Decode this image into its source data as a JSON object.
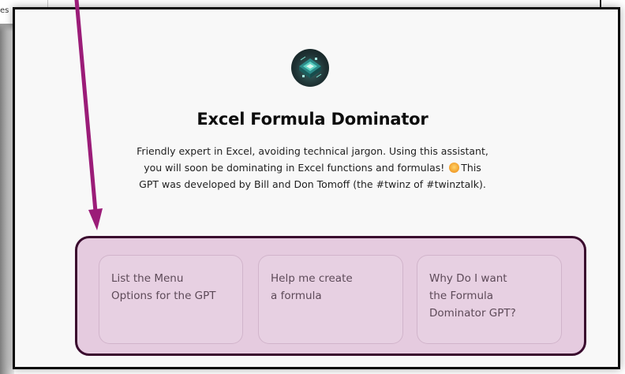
{
  "background_window": {
    "text_fragment": "es"
  },
  "gpt": {
    "name": "Excel Formula Dominator",
    "description_line1": "Friendly expert in Excel, avoiding technical jargon. Using this assistant,",
    "description_line2a": "you will soon be dominating in Excel functions and formulas! ",
    "description_line2b": "This",
    "description_line3": "GPT was developed by Bill and Don Tomoff (the #twinz of #twinztalk)."
  },
  "conversation_starters": [
    {
      "label": "List the Menu\nOptions for the GPT"
    },
    {
      "label": "Help me create\na formula"
    },
    {
      "label": "Why Do I want\nthe Formula\nDominator GPT?"
    }
  ],
  "annotation": {
    "arrow_color": "#9b1c78",
    "highlight_border_color": "#3a0b2e",
    "highlight_fill_color": "#ca8cbc"
  },
  "icons": {
    "avatar": "circuit-board-avatar-icon",
    "emoji": "star-struck-emoji-icon"
  }
}
